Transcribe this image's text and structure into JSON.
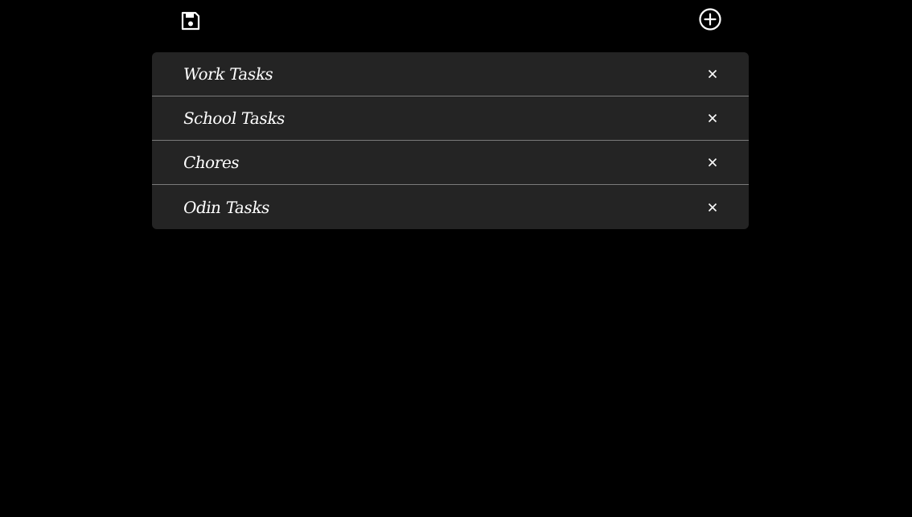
{
  "toolbar": {
    "save_icon": "floppy-disk-icon",
    "add_icon": "circle-plus-icon"
  },
  "lists": [
    {
      "label": "Work Tasks",
      "remove_icon": "close-icon"
    },
    {
      "label": "School Tasks",
      "remove_icon": "close-icon"
    },
    {
      "label": "Chores",
      "remove_icon": "close-icon"
    },
    {
      "label": "Odin Tasks",
      "remove_icon": "close-icon"
    }
  ],
  "colors": {
    "background": "#000000",
    "panel": "#242424",
    "divider": "#7a7a7a",
    "text": "#ffffff"
  }
}
